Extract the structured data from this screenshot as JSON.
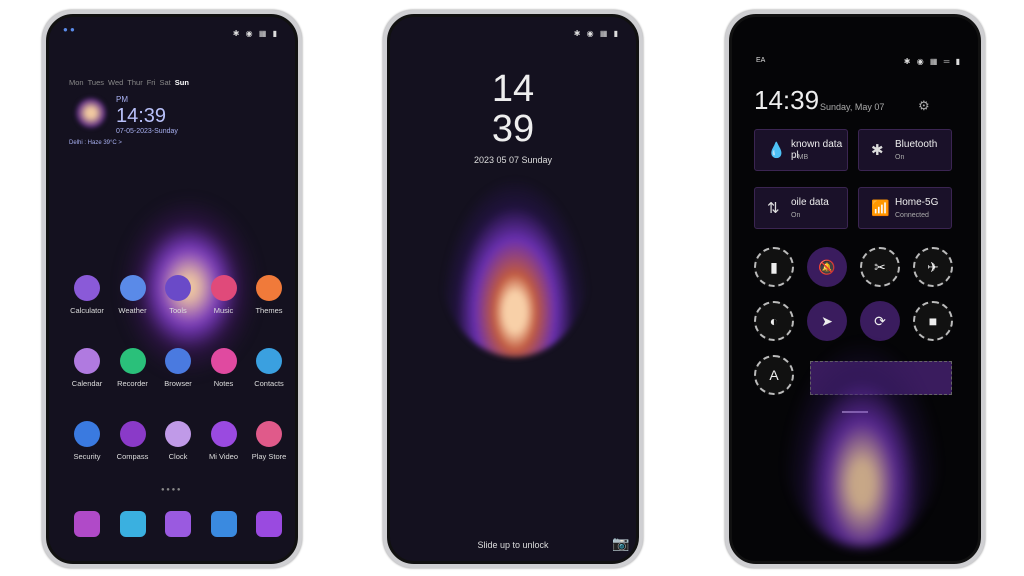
{
  "home": {
    "weekdays": [
      "Mon",
      "Tues",
      "Wed",
      "Thur",
      "Fri",
      "Sat",
      "Sun"
    ],
    "ampm": "PM",
    "time": "14:39",
    "date": "07-05-2023-Sunday",
    "weather": "Delhi : Haze 39°C  >",
    "apps": [
      {
        "label": "Calculator",
        "color": "#8a5ad8"
      },
      {
        "label": "Weather",
        "color": "#5a8ae8"
      },
      {
        "label": "Tools",
        "color": "#6a4ac8"
      },
      {
        "label": "Music",
        "color": "#e04a7a"
      },
      {
        "label": "Themes",
        "color": "#f07a3a"
      },
      {
        "label": "Calendar",
        "color": "#b07ae0"
      },
      {
        "label": "Recorder",
        "color": "#2ac07a"
      },
      {
        "label": "Browser",
        "color": "#4a7ae0"
      },
      {
        "label": "Notes",
        "color": "#e04aa0"
      },
      {
        "label": "Contacts",
        "color": "#3aa0e0"
      },
      {
        "label": "Security",
        "color": "#3a7ae0"
      },
      {
        "label": "Compass",
        "color": "#8a3ac8"
      },
      {
        "label": "Clock",
        "color": "#c09ae8"
      },
      {
        "label": "Mi Video",
        "color": "#9a4ae0"
      },
      {
        "label": "Play Store",
        "color": "#e05a8a"
      }
    ],
    "dock": [
      {
        "name": "phone",
        "color": "#b04ac8"
      },
      {
        "name": "messages",
        "color": "#3ab0e0"
      },
      {
        "name": "themes-star",
        "color": "#9a5ae0"
      },
      {
        "name": "files",
        "color": "#3a8ae0"
      },
      {
        "name": "camera",
        "color": "#9a4ae0"
      }
    ]
  },
  "lock": {
    "hour": "14",
    "minute": "39",
    "date": "2023  05 07  Sunday",
    "unlock": "Slide up to unlock"
  },
  "control": {
    "carrier": "EA",
    "time": "14:39",
    "date": "Sunday, May 07",
    "tiles": [
      {
        "title": "known data pl",
        "sub": "-- MB",
        "icon": "💧"
      },
      {
        "title": "Bluetooth",
        "sub": "On",
        "icon": "✱"
      },
      {
        "title": "oile data",
        "sub": "On",
        "icon": "⇅"
      },
      {
        "title": "Home-5G",
        "sub": "Connected",
        "icon": "📶"
      }
    ],
    "toggles": [
      {
        "name": "flashlight",
        "glyph": "▮",
        "on": false
      },
      {
        "name": "mute",
        "glyph": "🔕",
        "on": true
      },
      {
        "name": "screenshot",
        "glyph": "✂",
        "on": false
      },
      {
        "name": "airplane",
        "glyph": "✈",
        "on": false
      },
      {
        "name": "dark-mode",
        "glyph": "◐",
        "on": false
      },
      {
        "name": "location",
        "glyph": "➤",
        "on": true
      },
      {
        "name": "rotation-lock",
        "glyph": "⟳",
        "on": true
      },
      {
        "name": "screen-record",
        "glyph": "■",
        "on": false
      },
      {
        "name": "auto-brightness",
        "glyph": "A",
        "on": false
      }
    ]
  }
}
